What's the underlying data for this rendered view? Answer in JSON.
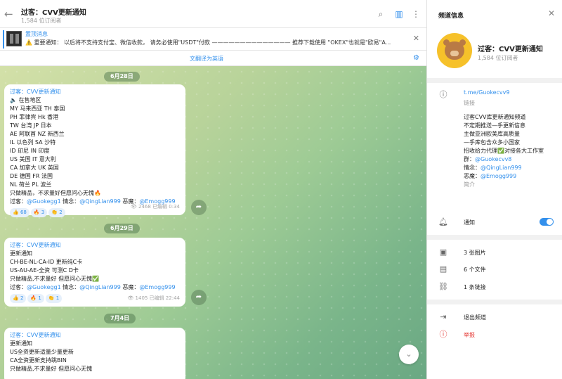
{
  "header": {
    "title": "过客：CVV更新通知",
    "subscribers": "1,584 位订阅者"
  },
  "pinned": {
    "title": "置顶消息",
    "text": "⚠️ 重要通知： 以后将不支持支付宝、微信收款， 请务必使用\"USDT\"付款 —————————————— 推荐下载使用 \"OKEX\"也就是\"欧易\"A..."
  },
  "translate": {
    "label": "翻译为英语"
  },
  "messages": [
    {
      "date": "6月28日",
      "channel": "过客：CVV更新通知",
      "lines": [
        "🔈 在售地区",
        "MY 马来西亚   TH  泰国",
        "PH 菲律宾     Hk  香港",
        "TW 台湾      JP  日本",
        "AE 阿联酋     NZ  新西兰",
        "IL  以色列     SA  沙特",
        "ID  印尼       IN  印度",
        "US  美国       IT   意大利",
        "CA 加拿大     UK  英国",
        "DE  德国       FR  法国",
        "NL 荷兰       PL 波兰",
        "只做精品，不求量好但愿问心无愧🔥"
      ],
      "footer": {
        "prefix": "过客：",
        "link1": "@Guokegg1",
        "mid1": " 情念：",
        "link2": "@QingLian999",
        "mid2": " 恶魔：",
        "link3": "@Emogg999"
      },
      "reactions": [
        "👍 68",
        "🔥 3",
        "👏 2"
      ],
      "views": "👁 2468",
      "edited": "已编辑 0:34"
    },
    {
      "date": "6月29日",
      "channel": "过客：CVV更新通知",
      "lines": [
        "更新通知",
        "CH-BE-NL-CA-ID 更新纯C卡",
        "US-AU-AE-全资 可测C D卡",
        "只做精品,不求量好 但愿问心无愧✅"
      ],
      "footer": {
        "prefix": "过客：",
        "link1": "@Guokegg1",
        "mid1": " 情念：",
        "link2": "@QingLian999",
        "mid2": " 恶魔：",
        "link3": "@Emogg999"
      },
      "reactions": [
        "👍 2",
        "🔥 1",
        "👏 1"
      ],
      "views": "👁 1405",
      "edited": "已编辑 22:44"
    },
    {
      "date": "7月4日",
      "channel": "过客：CVV更新通知",
      "lines": [
        "更新通知",
        "US全资更新适量少量更新",
        "CA全资更新支持跳BIN",
        "只做精品,不求量好 但愿问心无愧"
      ]
    }
  ],
  "sidebar": {
    "title": "频道信息",
    "channel_name": "过客：CVV更新通知",
    "subscribers": "1,584 位订阅者",
    "link": "t.me/Guokecvv9",
    "link_label": "链接",
    "description_lines": [
      "过客CVV库更新通知频道",
      "不定期推送—手更新信息",
      "主做亚洲欧美库高质量",
      "—手库包含众多小国家",
      "招收给力代理✅对接各大工作室"
    ],
    "contacts": [
      {
        "label": "群：",
        "link": "@Guokecvv8"
      },
      {
        "label": "情念：",
        "link": "@QingLian999"
      },
      {
        "label": "恶魔：",
        "link": "@Emogg999"
      }
    ],
    "intro_label": "简介",
    "notifications_label": "通知",
    "photos": "3 张图片",
    "files": "6 个文件",
    "links": "1 条链接",
    "leave": "退出频道",
    "report": "举报"
  },
  "icons": {
    "back": "back-arrow-icon",
    "search": "search-icon",
    "sidebar": "sidebar-toggle-icon",
    "more": "more-vertical-icon",
    "close": "close-icon",
    "info": "info-icon",
    "bell": "bell-icon",
    "photo": "photo-icon",
    "file": "file-icon",
    "link": "link-icon",
    "leave": "leave-icon",
    "report": "report-icon",
    "share": "share-icon",
    "scroll": "chevron-down-icon"
  },
  "colors": {
    "accent": "#3390ec",
    "danger": "#e53935"
  }
}
